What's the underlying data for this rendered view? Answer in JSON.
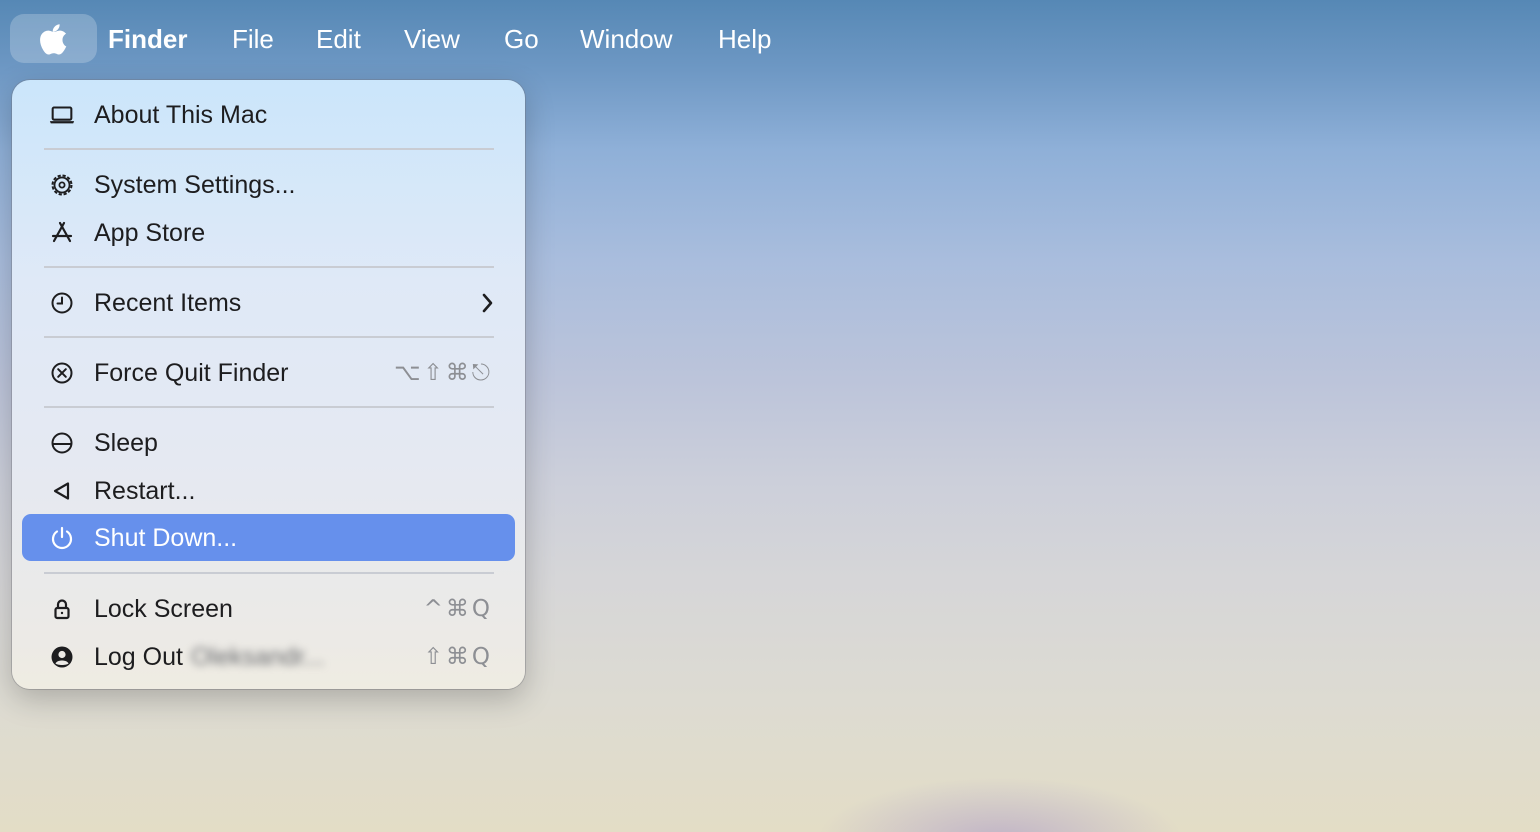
{
  "menubar": {
    "apple_icon": "apple-logo-icon",
    "app_name": "Finder",
    "menus": [
      "File",
      "Edit",
      "View",
      "Go",
      "Window",
      "Help"
    ]
  },
  "apple_menu": {
    "about": "About This Mac",
    "system_settings": "System Settings...",
    "app_store": "App Store",
    "recent_items": "Recent Items",
    "force_quit": "Force Quit Finder",
    "force_quit_shortcut": "⌥⇧⌘⎋",
    "sleep": "Sleep",
    "restart": "Restart...",
    "shut_down": "Shut Down...",
    "lock_screen": "Lock Screen",
    "lock_screen_shortcut": "^⌘Q",
    "log_out": "Log Out",
    "log_out_user": "Oleksandr...",
    "log_out_shortcut": "⇧⌘Q",
    "highlighted_item": "Shut Down..."
  },
  "colors": {
    "highlight": "#6690ec",
    "menu_text": "#1d1d1f",
    "shortcut_text": "#8d8f94"
  }
}
